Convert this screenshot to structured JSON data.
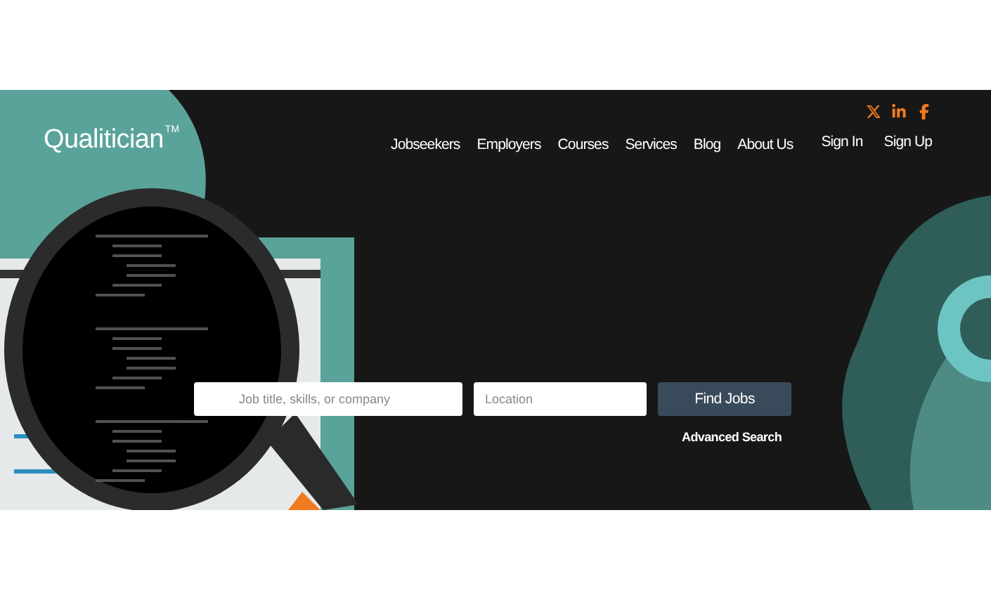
{
  "logo": {
    "name": "Qualitician",
    "mark": "TM"
  },
  "social_links": [
    {
      "kind": "x"
    },
    {
      "kind": "linkedin"
    },
    {
      "kind": "facebook"
    }
  ],
  "nav": {
    "items": [
      "Jobseekers",
      "Employers",
      "Courses",
      "Services",
      "Blog",
      "About Us"
    ],
    "auth": [
      "Sign In",
      "Sign Up"
    ]
  },
  "search": {
    "job_field": {
      "placeholder": "Job title, skills, or company"
    },
    "location_field": {
      "placeholder": "Location"
    },
    "button": "Find Jobs",
    "advanced_link": "Advanced Search"
  }
}
